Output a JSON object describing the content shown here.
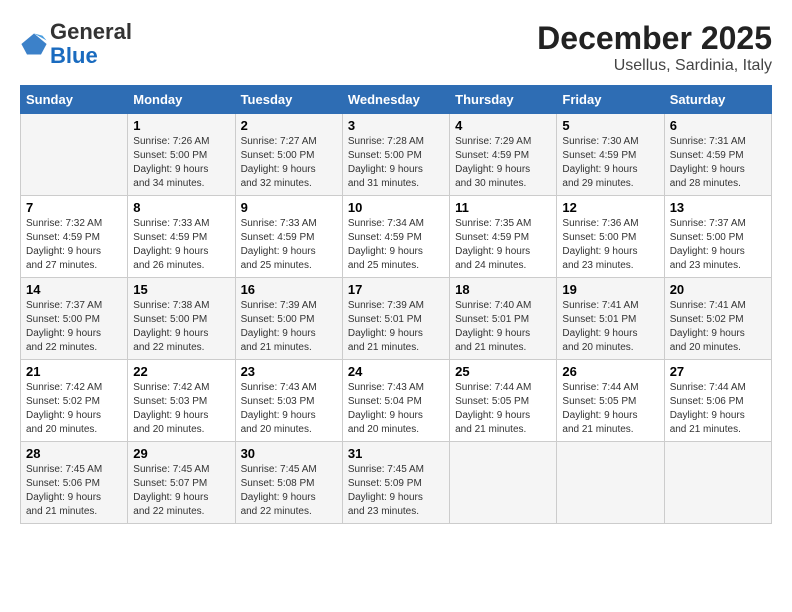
{
  "logo": {
    "general": "General",
    "blue": "Blue"
  },
  "title": "December 2025",
  "location": "Usellus, Sardinia, Italy",
  "days_of_week": [
    "Sunday",
    "Monday",
    "Tuesday",
    "Wednesday",
    "Thursday",
    "Friday",
    "Saturday"
  ],
  "weeks": [
    [
      {
        "day": "",
        "info": ""
      },
      {
        "day": "1",
        "info": "Sunrise: 7:26 AM\nSunset: 5:00 PM\nDaylight: 9 hours\nand 34 minutes."
      },
      {
        "day": "2",
        "info": "Sunrise: 7:27 AM\nSunset: 5:00 PM\nDaylight: 9 hours\nand 32 minutes."
      },
      {
        "day": "3",
        "info": "Sunrise: 7:28 AM\nSunset: 5:00 PM\nDaylight: 9 hours\nand 31 minutes."
      },
      {
        "day": "4",
        "info": "Sunrise: 7:29 AM\nSunset: 4:59 PM\nDaylight: 9 hours\nand 30 minutes."
      },
      {
        "day": "5",
        "info": "Sunrise: 7:30 AM\nSunset: 4:59 PM\nDaylight: 9 hours\nand 29 minutes."
      },
      {
        "day": "6",
        "info": "Sunrise: 7:31 AM\nSunset: 4:59 PM\nDaylight: 9 hours\nand 28 minutes."
      }
    ],
    [
      {
        "day": "7",
        "info": "Sunrise: 7:32 AM\nSunset: 4:59 PM\nDaylight: 9 hours\nand 27 minutes."
      },
      {
        "day": "8",
        "info": "Sunrise: 7:33 AM\nSunset: 4:59 PM\nDaylight: 9 hours\nand 26 minutes."
      },
      {
        "day": "9",
        "info": "Sunrise: 7:33 AM\nSunset: 4:59 PM\nDaylight: 9 hours\nand 25 minutes."
      },
      {
        "day": "10",
        "info": "Sunrise: 7:34 AM\nSunset: 4:59 PM\nDaylight: 9 hours\nand 25 minutes."
      },
      {
        "day": "11",
        "info": "Sunrise: 7:35 AM\nSunset: 4:59 PM\nDaylight: 9 hours\nand 24 minutes."
      },
      {
        "day": "12",
        "info": "Sunrise: 7:36 AM\nSunset: 5:00 PM\nDaylight: 9 hours\nand 23 minutes."
      },
      {
        "day": "13",
        "info": "Sunrise: 7:37 AM\nSunset: 5:00 PM\nDaylight: 9 hours\nand 23 minutes."
      }
    ],
    [
      {
        "day": "14",
        "info": "Sunrise: 7:37 AM\nSunset: 5:00 PM\nDaylight: 9 hours\nand 22 minutes."
      },
      {
        "day": "15",
        "info": "Sunrise: 7:38 AM\nSunset: 5:00 PM\nDaylight: 9 hours\nand 22 minutes."
      },
      {
        "day": "16",
        "info": "Sunrise: 7:39 AM\nSunset: 5:00 PM\nDaylight: 9 hours\nand 21 minutes."
      },
      {
        "day": "17",
        "info": "Sunrise: 7:39 AM\nSunset: 5:01 PM\nDaylight: 9 hours\nand 21 minutes."
      },
      {
        "day": "18",
        "info": "Sunrise: 7:40 AM\nSunset: 5:01 PM\nDaylight: 9 hours\nand 21 minutes."
      },
      {
        "day": "19",
        "info": "Sunrise: 7:41 AM\nSunset: 5:01 PM\nDaylight: 9 hours\nand 20 minutes."
      },
      {
        "day": "20",
        "info": "Sunrise: 7:41 AM\nSunset: 5:02 PM\nDaylight: 9 hours\nand 20 minutes."
      }
    ],
    [
      {
        "day": "21",
        "info": "Sunrise: 7:42 AM\nSunset: 5:02 PM\nDaylight: 9 hours\nand 20 minutes."
      },
      {
        "day": "22",
        "info": "Sunrise: 7:42 AM\nSunset: 5:03 PM\nDaylight: 9 hours\nand 20 minutes."
      },
      {
        "day": "23",
        "info": "Sunrise: 7:43 AM\nSunset: 5:03 PM\nDaylight: 9 hours\nand 20 minutes."
      },
      {
        "day": "24",
        "info": "Sunrise: 7:43 AM\nSunset: 5:04 PM\nDaylight: 9 hours\nand 20 minutes."
      },
      {
        "day": "25",
        "info": "Sunrise: 7:44 AM\nSunset: 5:05 PM\nDaylight: 9 hours\nand 21 minutes."
      },
      {
        "day": "26",
        "info": "Sunrise: 7:44 AM\nSunset: 5:05 PM\nDaylight: 9 hours\nand 21 minutes."
      },
      {
        "day": "27",
        "info": "Sunrise: 7:44 AM\nSunset: 5:06 PM\nDaylight: 9 hours\nand 21 minutes."
      }
    ],
    [
      {
        "day": "28",
        "info": "Sunrise: 7:45 AM\nSunset: 5:06 PM\nDaylight: 9 hours\nand 21 minutes."
      },
      {
        "day": "29",
        "info": "Sunrise: 7:45 AM\nSunset: 5:07 PM\nDaylight: 9 hours\nand 22 minutes."
      },
      {
        "day": "30",
        "info": "Sunrise: 7:45 AM\nSunset: 5:08 PM\nDaylight: 9 hours\nand 22 minutes."
      },
      {
        "day": "31",
        "info": "Sunrise: 7:45 AM\nSunset: 5:09 PM\nDaylight: 9 hours\nand 23 minutes."
      },
      {
        "day": "",
        "info": ""
      },
      {
        "day": "",
        "info": ""
      },
      {
        "day": "",
        "info": ""
      }
    ]
  ]
}
